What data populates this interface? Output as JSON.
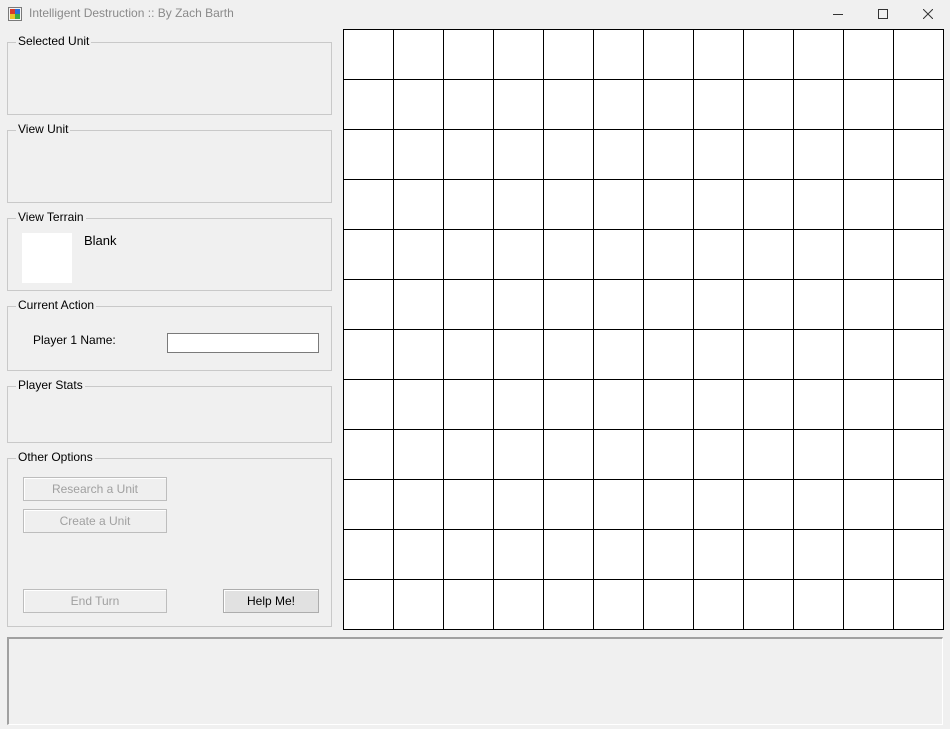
{
  "window": {
    "title": "Intelligent Destruction :: By Zach Barth",
    "controls": [
      "minimize-icon",
      "maximize-icon",
      "close-icon"
    ]
  },
  "sidebar": {
    "selected_unit": {
      "label": "Selected Unit"
    },
    "view_unit": {
      "label": "View Unit"
    },
    "view_terrain": {
      "label": "View Terrain",
      "terrain_name": "Blank",
      "terrain_color": "#ffffff"
    },
    "current_action": {
      "label": "Current Action",
      "field_label": "Player 1 Name:",
      "field_value": ""
    },
    "player_stats": {
      "label": "Player Stats"
    },
    "other_options": {
      "label": "Other Options",
      "research_label": "Research a Unit",
      "create_label": "Create a Unit",
      "end_turn_label": "End Turn",
      "help_label": "Help Me!"
    }
  },
  "board": {
    "rows": 12,
    "cols": 12,
    "cell_color": "#ffffff",
    "line_color": "#000000"
  },
  "log": {
    "text": ""
  }
}
